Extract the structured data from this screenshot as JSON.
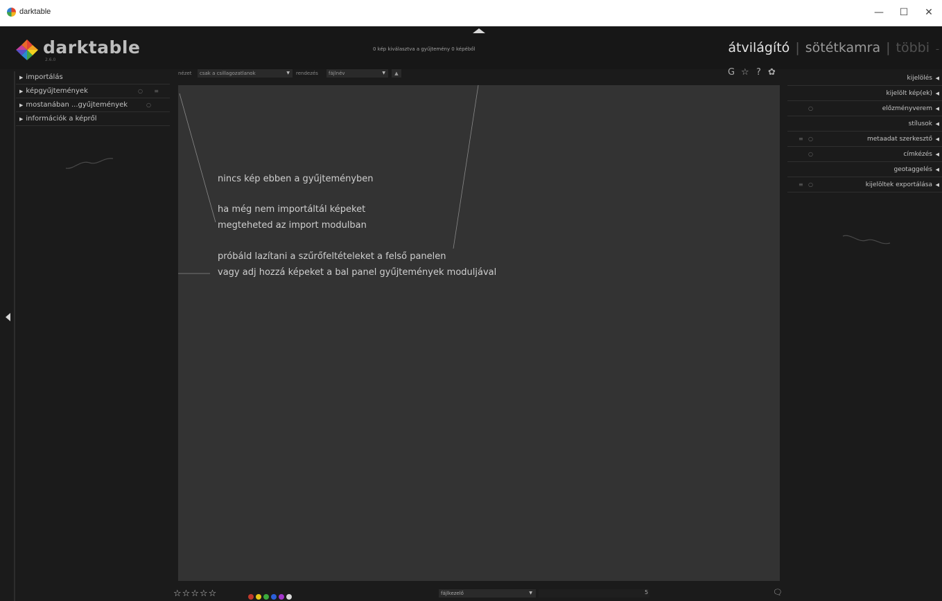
{
  "window": {
    "title": "darktable",
    "minimize_label": "—",
    "maximize_label": "☐",
    "close_label": "✕"
  },
  "header": {
    "logo_text": "darktable",
    "version": "2.6.0",
    "collection_info": "0 kép kiválasztva a gyűjtemény 0 képéből",
    "views": [
      {
        "label": "átvilágító",
        "state": "active"
      },
      {
        "label": "sötétkamra",
        "state": "inactive"
      },
      {
        "label": "többi",
        "state": "dim"
      }
    ],
    "view_separator": "|"
  },
  "filterbar": {
    "view_label": "nézet",
    "view_value": "csak a csillagozatlanok",
    "sort_label": "rendezés",
    "sort_value": "fájlnév",
    "sort_direction": "▲",
    "icons": [
      "grouping-icon",
      "overlay-star-icon",
      "help-icon",
      "preferences-icon"
    ],
    "icon_glyphs": [
      "G",
      "☆",
      "?",
      "✿"
    ]
  },
  "left_panel": {
    "modules": [
      {
        "label": "importálás"
      },
      {
        "label": "képgyűjtemények"
      },
      {
        "label": "mostanában ...gyűjtemények"
      },
      {
        "label": "információk a képről"
      }
    ]
  },
  "center": {
    "messages": [
      "nincs kép ebben a gyűjteményben",
      "ha még nem importáltál képeket",
      "megteheted az import modulban",
      "próbáld lazítani a szűrőfeltételeket a felső panelen",
      "vagy adj hozzá képeket a bal panel gyűjtemények moduljával"
    ]
  },
  "right_panel": {
    "modules": [
      {
        "label": "kijelölés"
      },
      {
        "label": "kijelölt kép(ek)"
      },
      {
        "label": "előzményverem"
      },
      {
        "label": "stílusok"
      },
      {
        "label": "metaadat szerkesztő"
      },
      {
        "label": "címkézés"
      },
      {
        "label": "geotaggelés"
      },
      {
        "label": "kijelöltek exportálása"
      }
    ]
  },
  "bottombar": {
    "star_rating": 0,
    "star_count": 5,
    "color_labels": [
      "#c0392b",
      "#e6c619",
      "#3cab3c",
      "#2b5fd9",
      "#a234c9",
      "#d8d8d8"
    ],
    "layout_value": "fájlkezelő",
    "zoom_value": "5"
  },
  "colors": {
    "background": "#1b1b1b",
    "center_area": "#333333",
    "text": "#c4c4c4"
  }
}
